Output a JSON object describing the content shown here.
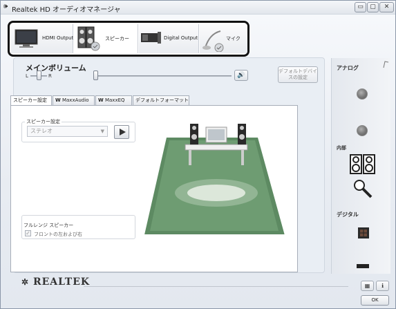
{
  "window": {
    "title": "Realtek HD オーディオマネージャ",
    "controls": {
      "minimize": "▭",
      "maximize": "▢",
      "close": "✕"
    }
  },
  "devices": [
    {
      "label": "HDMI Output",
      "icon": "monitor-icon",
      "selected": false
    },
    {
      "label": "スピーカー",
      "icon": "speaker-icon",
      "selected": true
    },
    {
      "label": "Digital Output",
      "icon": "digital-output-icon",
      "selected": false
    },
    {
      "label": "マイク",
      "icon": "microphone-icon",
      "selected": false
    }
  ],
  "main_volume": {
    "title": "メインボリューム",
    "left_label": "L",
    "right_label": "R",
    "default_device_button": "デフォルトデバイスの設定",
    "speaker_icon": "speaker-volume-icon"
  },
  "tabs": [
    "スピーカー設定",
    "MaxxAudio",
    "MaxxEQ",
    "デフォルトフォーマット"
  ],
  "speaker_settings": {
    "group_label": "スピーカー設定",
    "selected_value": "ステレオ",
    "play_icon": "play-icon",
    "full_range_label": "フルレンジ スピーカー",
    "full_range_checkbox_label": "フロントの左および右",
    "full_range_checked": true
  },
  "right_panel": {
    "analog": "アナログ",
    "inner": "内部",
    "digital": "デジタル"
  },
  "footer": {
    "brand": "REALTEK",
    "ok": "OK",
    "info_icon": "info-icon",
    "hd_icon": "device-info-icon"
  }
}
